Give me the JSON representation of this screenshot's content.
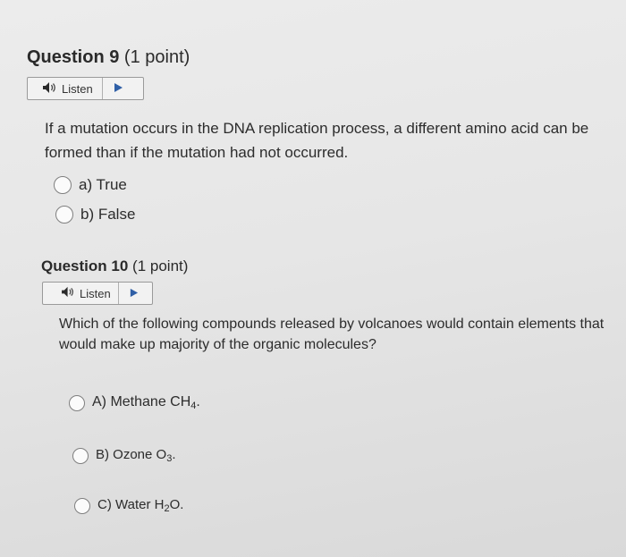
{
  "q9": {
    "number": "Question 9",
    "points": "(1 point)",
    "listen_label": "Listen",
    "text": "If a mutation occurs in the DNA replication process, a different amino acid can be formed than if the mutation had not occurred.",
    "options": [
      "a) True",
      "b) False"
    ]
  },
  "q10": {
    "number": "Question 10",
    "points": "(1 point)",
    "listen_label": "Listen",
    "text": "Which of the following compounds released by volcanoes would contain elements that would make up majority of the organic molecules?",
    "options": [
      {
        "label": "A) Methane CH",
        "sub": "4",
        "suffix": "."
      },
      {
        "label": "B) Ozone O",
        "sub": "3",
        "suffix": "."
      },
      {
        "label": "C) Water H",
        "sub": "2",
        "suffix": "O."
      }
    ]
  },
  "icons": {
    "speaker": "speaker-icon",
    "play": "play-icon"
  }
}
